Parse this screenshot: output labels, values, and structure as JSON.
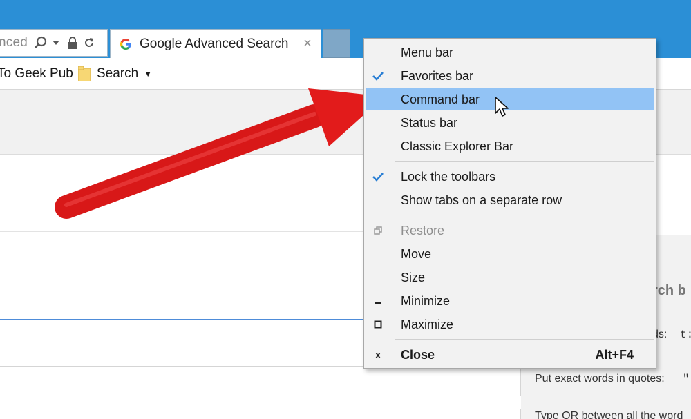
{
  "address_bar": {
    "text": "nced",
    "icons": [
      "search-icon",
      "dropdown-arrow-icon",
      "lock-icon",
      "refresh-icon"
    ]
  },
  "tab": {
    "title": "Google Advanced Search",
    "favicon": "google-g-icon",
    "close_label": "×"
  },
  "favorites": [
    {
      "label": "To Geek Pub"
    },
    {
      "label": "Search",
      "icon": "folder-icon",
      "has_dropdown": true
    }
  ],
  "context_menu": {
    "items": [
      {
        "label": "Menu bar",
        "checked": false
      },
      {
        "label": "Favorites bar",
        "checked": true
      },
      {
        "label": "Command bar",
        "checked": false,
        "highlighted": true
      },
      {
        "label": "Status bar",
        "checked": false
      },
      {
        "label": "Classic Explorer Bar",
        "checked": false
      },
      {
        "label": "Lock the toolbars",
        "checked": true
      },
      {
        "label": "Show tabs on a separate row",
        "checked": false
      },
      {
        "label": "Restore",
        "disabled": true,
        "icon": "restore-icon"
      },
      {
        "label": "Move"
      },
      {
        "label": "Size"
      },
      {
        "label": "Minimize",
        "icon": "minimize-icon"
      },
      {
        "label": "Maximize",
        "icon": "maximize-icon"
      },
      {
        "label": "Close",
        "icon": "close-icon",
        "shortcut": "Alt+F4",
        "bold": true
      }
    ]
  },
  "right_panel": {
    "heading_fragment": "rch b",
    "line1_label": "ds:",
    "line1_code": "t:",
    "line2": "Put exact words in quotes:",
    "line2_code": "\"",
    "line3": "Type OR between all the word"
  },
  "colors": {
    "titlebar": "#2b8fd6",
    "menu_highlight": "#92c3f5",
    "check": "#2a7fd4",
    "arrow": "#e21b1b"
  }
}
